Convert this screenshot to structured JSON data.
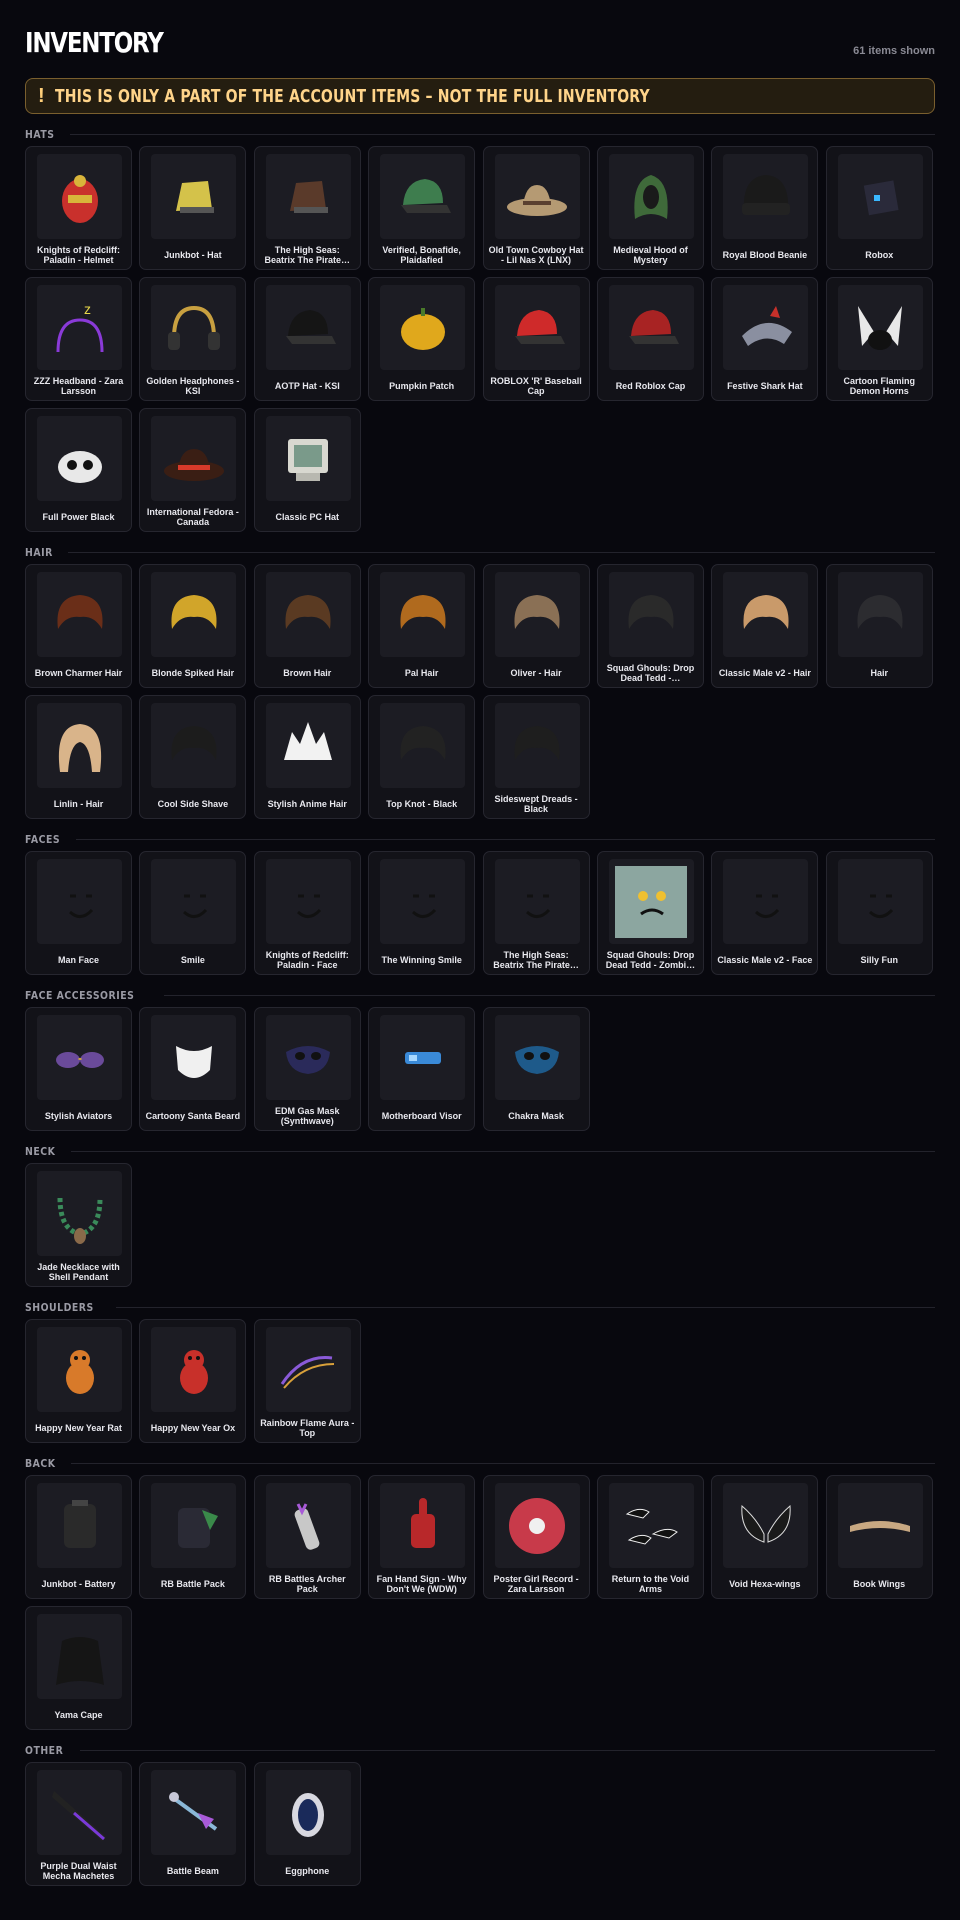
{
  "header": {
    "title": "INVENTORY",
    "count": "61 items shown"
  },
  "banner": {
    "icon": "!",
    "text": "THIS IS ONLY A PART OF THE ACCOUNT ITEMS – NOT THE FULL INVENTORY",
    "color": "#ffd48a"
  },
  "sections": [
    {
      "title": "HATS",
      "items": [
        {
          "name": "Knights of Redcliff: Paladin - Helmet",
          "icon": "helmet",
          "color": "#c9302c"
        },
        {
          "name": "Junkbot - Hat",
          "icon": "hat",
          "color": "#d4c24a"
        },
        {
          "name": "The High Seas: Beatrix The Pirate…",
          "icon": "hat",
          "color": "#5a3a2a"
        },
        {
          "name": "Verified, Bonafide, Plaidafied",
          "icon": "cap",
          "color": "#3e7d4e"
        },
        {
          "name": "Old Town Cowboy Hat - Lil Nas X (LNX)",
          "icon": "cowboy-hat",
          "color": "#b59a73"
        },
        {
          "name": "Medieval Hood of Mystery",
          "icon": "hood",
          "color": "#3f6a3a"
        },
        {
          "name": "Royal Blood Beanie",
          "icon": "beanie",
          "color": "#1a1a1a"
        },
        {
          "name": "Robox",
          "icon": "box",
          "color": "#2a2a3a"
        },
        {
          "name": "ZZZ Headband - Zara Larsson",
          "icon": "headband",
          "color": "#8a3ad8"
        },
        {
          "name": "Golden Headphones - KSI",
          "icon": "headphones",
          "color": "#333333"
        },
        {
          "name": "AOTP Hat - KSI",
          "icon": "cap",
          "color": "#151515"
        },
        {
          "name": "Pumpkin Patch",
          "icon": "pumpkin",
          "color": "#e0a81c"
        },
        {
          "name": "ROBLOX 'R' Baseball Cap",
          "icon": "cap",
          "color": "#cf2a2a"
        },
        {
          "name": "Red Roblox Cap",
          "icon": "cap",
          "color": "#a82323"
        },
        {
          "name": "Festive Shark Hat",
          "icon": "shark",
          "color": "#8a8fa0"
        },
        {
          "name": "Cartoon Flaming Demon Horns",
          "icon": "horns",
          "color": "#e8e8e8"
        },
        {
          "name": "Full Power Black",
          "icon": "crown",
          "color": "#e8e8e8"
        },
        {
          "name": "International Fedora - Canada",
          "icon": "fedora",
          "color": "#3a1e14"
        },
        {
          "name": "Classic PC Hat",
          "icon": "monitor",
          "color": "#d8d8d0"
        }
      ]
    },
    {
      "title": "HAIR",
      "items": [
        {
          "name": "Brown Charmer Hair",
          "icon": "hair",
          "color": "#6a2e18"
        },
        {
          "name": "Blonde Spiked Hair",
          "icon": "hair",
          "color": "#d1a52a"
        },
        {
          "name": "Brown Hair",
          "icon": "hair",
          "color": "#5a3a22"
        },
        {
          "name": "Pal Hair",
          "icon": "hair",
          "color": "#b06a1e"
        },
        {
          "name": "Oliver - Hair",
          "icon": "hair",
          "color": "#8a7055"
        },
        {
          "name": "Squad Ghouls: Drop Dead Tedd -…",
          "icon": "hair",
          "color": "#2a2a2a"
        },
        {
          "name": "Classic Male v2 - Hair",
          "icon": "hair",
          "color": "#c99a6a"
        },
        {
          "name": "Hair",
          "icon": "hair",
          "color": "#2c2c30"
        },
        {
          "name": "Linlin - Hair",
          "icon": "long-hair",
          "color": "#d9b48a"
        },
        {
          "name": "Cool Side Shave",
          "icon": "hair",
          "color": "#1c1c1c"
        },
        {
          "name": "Stylish Anime Hair",
          "icon": "anime-hair",
          "color": "#f2f2f2"
        },
        {
          "name": "Top Knot - Black",
          "icon": "hair",
          "color": "#222222"
        },
        {
          "name": "Sideswept Dreads - Black",
          "icon": "hair",
          "color": "#1e1e1e"
        }
      ]
    },
    {
      "title": "FACES",
      "items": [
        {
          "name": "Man Face",
          "icon": "face",
          "color": "#1b1b22"
        },
        {
          "name": "Smile",
          "icon": "face",
          "color": "#1b1b22"
        },
        {
          "name": "Knights of Redcliff: Paladin - Face",
          "icon": "face",
          "color": "#1b1b22"
        },
        {
          "name": "The Winning Smile",
          "icon": "face",
          "color": "#1b1b22"
        },
        {
          "name": "The High Seas: Beatrix The Pirate…",
          "icon": "face",
          "color": "#1b1b22"
        },
        {
          "name": "Squad Ghouls: Drop Dead Tedd - Zombi…",
          "icon": "zombie-face",
          "color": "#8ca6a0"
        },
        {
          "name": "Classic Male v2 - Face",
          "icon": "face",
          "color": "#1b1b22"
        },
        {
          "name": "Silly Fun",
          "icon": "face",
          "color": "#1b1b22"
        }
      ]
    },
    {
      "title": "FACE ACCESSORIES",
      "items": [
        {
          "name": "Stylish Aviators",
          "icon": "glasses",
          "color": "#6a4a9a"
        },
        {
          "name": "Cartoony Santa Beard",
          "icon": "beard",
          "color": "#f0f0f0"
        },
        {
          "name": "EDM Gas Mask (Synthwave)",
          "icon": "mask",
          "color": "#2a2a5a"
        },
        {
          "name": "Motherboard Visor",
          "icon": "visor",
          "color": "#3a8ad8"
        },
        {
          "name": "Chakra Mask",
          "icon": "mask",
          "color": "#1e5a8a"
        }
      ]
    },
    {
      "title": "NECK",
      "items": [
        {
          "name": "Jade Necklace with Shell Pendant",
          "icon": "necklace",
          "color": "#3a8a5a"
        }
      ]
    },
    {
      "title": "SHOULDERS",
      "items": [
        {
          "name": "Happy New Year Rat",
          "icon": "pet",
          "color": "#d87a2a"
        },
        {
          "name": "Happy New Year Ox",
          "icon": "pet",
          "color": "#c8302a"
        },
        {
          "name": "Rainbow Flame Aura - Top",
          "icon": "flame",
          "color": "#8a5ad8"
        }
      ]
    },
    {
      "title": "BACK",
      "items": [
        {
          "name": "Junkbot - Battery",
          "icon": "battery",
          "color": "#2a2a2a"
        },
        {
          "name": "RB Battle Pack",
          "icon": "backpack",
          "color": "#3a8a4a"
        },
        {
          "name": "RB Battles Archer Pack",
          "icon": "quiver",
          "color": "#c8c8c8"
        },
        {
          "name": "Fan Hand Sign - Why Don't We (WDW)",
          "icon": "foam-hand",
          "color": "#b8282a"
        },
        {
          "name": "Poster Girl Record - Zara Larsson",
          "icon": "record",
          "color": "#c83a4a"
        },
        {
          "name": "Return to the Void Arms",
          "icon": "void-arms",
          "color": "#111111"
        },
        {
          "name": "Void Hexa-wings",
          "icon": "wings",
          "color": "#1a1a1a"
        },
        {
          "name": "Book Wings",
          "icon": "book-wings",
          "color": "#c8a882"
        },
        {
          "name": "Yama Cape",
          "icon": "cape",
          "color": "#151515"
        }
      ]
    },
    {
      "title": "OTHER",
      "items": [
        {
          "name": "Purple Dual Waist Mecha Machetes",
          "icon": "blade",
          "color": "#7a3ad8"
        },
        {
          "name": "Battle Beam",
          "icon": "beam",
          "color": "#8ab8d8"
        },
        {
          "name": "Eggphone",
          "icon": "egg",
          "color": "#d8d8e0"
        }
      ]
    }
  ]
}
